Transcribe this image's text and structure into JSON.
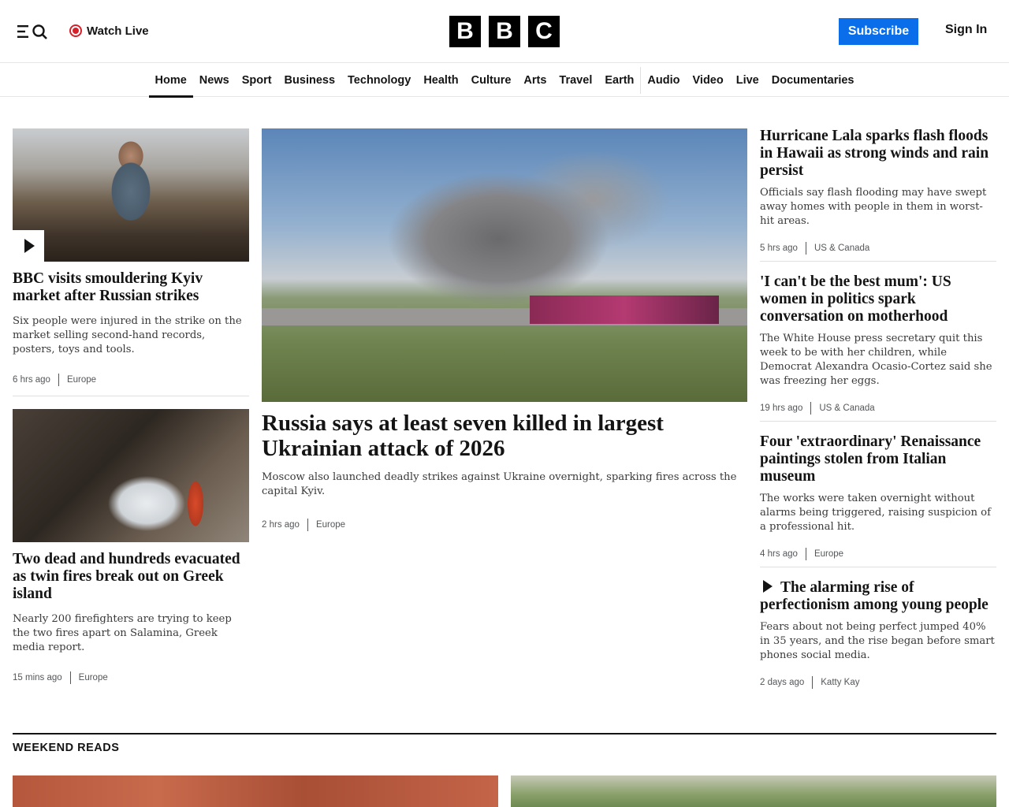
{
  "header": {
    "watch_live": "Watch Live",
    "logo": [
      "B",
      "B",
      "C"
    ],
    "subscribe": "Subscribe",
    "sign_in": "Sign In"
  },
  "nav": [
    "Home",
    "News",
    "Sport",
    "Business",
    "Technology",
    "Health",
    "Culture",
    "Arts",
    "Travel",
    "Earth",
    "Audio",
    "Video",
    "Live",
    "Documentaries"
  ],
  "stories": {
    "kyiv": {
      "headline": "BBC visits smouldering Kyiv market after Russian strikes",
      "summary": "Six people were injured in the strike on the market selling second-hand records, posters, toys and tools.",
      "time": "6 hrs ago",
      "section": "Europe"
    },
    "greek": {
      "headline": "Two dead and hundreds evacuated as twin fires break out on Greek island",
      "summary": "Nearly 200 firefighters are trying to keep the two fires apart on Salamina, Greek media report.",
      "time": "15 mins ago",
      "section": "Europe"
    },
    "main": {
      "headline": "Russia says at least seven killed in largest Ukrainian attack of 2026",
      "summary": "Moscow also launched deadly strikes against Ukraine overnight, sparking fires across the capital Kyiv.",
      "time": "2 hrs ago",
      "section": "Europe"
    },
    "hurricane": {
      "headline": "Hurricane Lala sparks flash floods in Hawaii as strong winds and rain persist",
      "summary": "Officials say flash flooding may have swept away homes with people in them in worst-hit areas.",
      "time": "5 hrs ago",
      "section": "US & Canada"
    },
    "mum": {
      "headline": "'I can't be the best mum': US women in politics spark conversation on motherhood",
      "summary": "The White House press secretary quit this week to be with her children, while Democrat Alexandra Ocasio-Cortez said she was freezing her eggs.",
      "time": "19 hrs ago",
      "section": "US & Canada"
    },
    "paintings": {
      "headline": "Four 'extraordinary' Renaissance paintings stolen from Italian museum",
      "summary": "The works were taken overnight without alarms being triggered, raising suspicion of a professional hit.",
      "time": "4 hrs ago",
      "section": "Europe"
    },
    "perfectionism": {
      "headline": "The alarming rise of perfectionism among young people",
      "summary": "Fears about not being perfect jumped 40% in 35 years, and the rise began before smart phones social media.",
      "time": "2 days ago",
      "section": "Katty Kay"
    }
  },
  "weekend_reads": {
    "title": "WEEKEND READS"
  }
}
